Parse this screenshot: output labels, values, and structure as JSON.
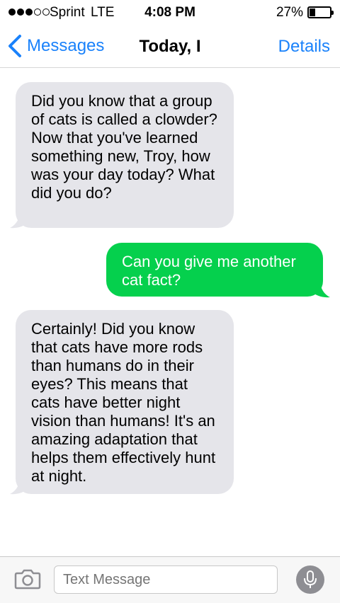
{
  "status_bar": {
    "carrier": "Sprint",
    "network": "LTE",
    "time": "4:08 PM",
    "battery": "27%",
    "battery_level": 0.27
  },
  "nav": {
    "back_label": "Messages",
    "title": "Today, I",
    "details_label": "Details"
  },
  "messages": [
    {
      "direction": "incoming",
      "text": "Did you know that a group of cats is called a clowder? Now that you've learned something new, Troy, how was your day today? What did you do?"
    },
    {
      "direction": "outgoing",
      "text": "Can you give me another cat fact?"
    },
    {
      "direction": "incoming",
      "text": "Certainly! Did you know that cats have more rods than humans do in their eyes? This means that cats have better night vision than humans! It's an amazing adaptation that helps them effectively hunt at night."
    }
  ],
  "composer": {
    "placeholder": "Text Message"
  },
  "colors": {
    "accent": "#1a82fb",
    "incoming_bubble": "#e5e5ea",
    "outgoing_bubble": "#05d04d"
  },
  "icons": [
    "signal-icon",
    "battery-icon",
    "chevron-left-icon",
    "camera-icon",
    "microphone-icon"
  ]
}
